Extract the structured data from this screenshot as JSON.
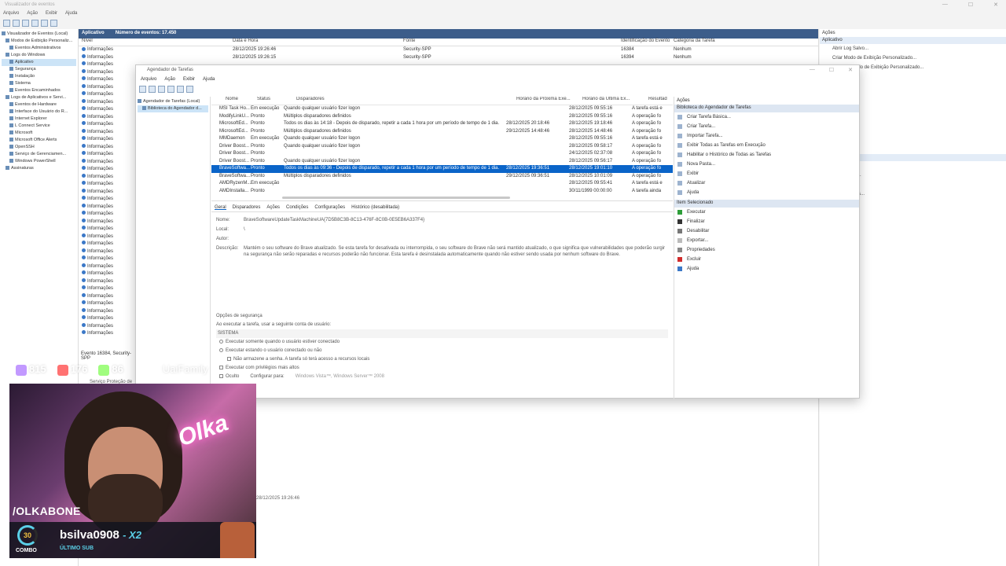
{
  "event_viewer": {
    "title": "Visualizador de eventos",
    "menu": [
      "Arquivo",
      "Ação",
      "Exibir",
      "Ajuda"
    ],
    "tree": [
      {
        "label": "Visualizador de Eventos (Local)",
        "indent": 0
      },
      {
        "label": "Modos de Exibição Personaliz...",
        "indent": 1
      },
      {
        "label": "Eventos Administrativos",
        "indent": 2
      },
      {
        "label": "Logs do Windows",
        "indent": 1
      },
      {
        "label": "Aplicativo",
        "indent": 2,
        "selected": true
      },
      {
        "label": "Segurança",
        "indent": 2
      },
      {
        "label": "Instalação",
        "indent": 2
      },
      {
        "label": "Sistema",
        "indent": 2
      },
      {
        "label": "Eventos Encaminhados",
        "indent": 2
      },
      {
        "label": "Logs de Aplicativos e Servi...",
        "indent": 1
      },
      {
        "label": "Eventos de Hardware",
        "indent": 2
      },
      {
        "label": "Interface do Usuário do R...",
        "indent": 2
      },
      {
        "label": "Internet Explorer",
        "indent": 2
      },
      {
        "label": "L Connect Service",
        "indent": 2
      },
      {
        "label": "Microsoft",
        "indent": 2
      },
      {
        "label": "Microsoft Office Alerts",
        "indent": 2
      },
      {
        "label": "OpenSSH",
        "indent": 2
      },
      {
        "label": "Serviço de Gerenciamen...",
        "indent": 2
      },
      {
        "label": "Windows PowerShell",
        "indent": 2
      },
      {
        "label": "Assinaturas",
        "indent": 1
      }
    ],
    "list_header": {
      "title": "Aplicativo",
      "count": "Número de eventos: 17.450"
    },
    "columns": [
      "Nível",
      "Data e Hora",
      "Fonte",
      "Identificação do Evento",
      "Categoria da Tarefa"
    ],
    "rows": [
      [
        "Informações",
        "28/12/2025 19:26:46",
        "Security-SPP",
        "16384",
        "Nenhum"
      ],
      [
        "Informações",
        "28/12/2025 19:26:15",
        "Security-SPP",
        "16394",
        "Nenhum"
      ]
    ],
    "info_label": "Informações",
    "bottom_event": "Evento 16384, Security-SPP",
    "bottom_tab": "Serviço Proteção de S...",
    "bottom_timestamp": "28/12/2025 19:26:46",
    "actions_title": "Ações",
    "actions_sub": "Aplicativo",
    "actions": [
      "Abrir Log Salvo...",
      "Criar Modo de Exibição Personalizado...",
      "Importar Modo de Exibição Personalizado...",
      "como...",
      "a este Log...",
      "-SPP",
      "r Evento",
      "este Evento...",
      "Selecionados..."
    ]
  },
  "task_scheduler": {
    "title": "Agendador de Tarefas",
    "menu": [
      "Arquivo",
      "Ação",
      "Exibir",
      "Ajuda"
    ],
    "tree": [
      "Agendador de Tarefas (Local)",
      "Biblioteca do Agendador d..."
    ],
    "columns": [
      "Nome",
      "Status",
      "Disparadores",
      "Horário da Próxima Exe...",
      "Horário da Última Ex...",
      "Resultad"
    ],
    "rows": [
      {
        "name": "MSI Task Ho...",
        "status": "Em execução",
        "trigger": "Quando qualquer usuário fizer logon",
        "next": "",
        "last": "28/12/2025 09:55:16",
        "result": "A tarefa está e"
      },
      {
        "name": "ModifyLinkU...",
        "status": "Pronto",
        "trigger": "Múltiplos disparadores definidos",
        "next": "",
        "last": "28/12/2025 09:55:16",
        "result": "A operação fo"
      },
      {
        "name": "MicrosoftEd...",
        "status": "Pronto",
        "trigger": "Todos os dias às 14:18 - Depois de disparado, repetir a cada 1 hora por um período de tempo de 1 dia.",
        "next": "28/12/2025 20:18:46",
        "last": "28/12/2025 19:18:46",
        "result": "A operação fo"
      },
      {
        "name": "MicrosoftEd...",
        "status": "Pronto",
        "trigger": "Múltiplos disparadores definidos",
        "next": "29/12/2025 14:48:46",
        "last": "28/12/2025 14:48:46",
        "result": "A operação fo"
      },
      {
        "name": "MMDaemon",
        "status": "Em execução",
        "trigger": "Quando qualquer usuário fizer logon",
        "next": "",
        "last": "28/12/2025 09:55:16",
        "result": "A tarefa está e"
      },
      {
        "name": "Driver Boost...",
        "status": "Pronto",
        "trigger": "Quando qualquer usuário fizer logon",
        "next": "",
        "last": "28/12/2025 09:58:17",
        "result": "A operação fo"
      },
      {
        "name": "Driver Boost...",
        "status": "Pronto",
        "trigger": "",
        "next": "",
        "last": "24/12/2025 02:37:08",
        "result": "A operação fo"
      },
      {
        "name": "Driver Boost...",
        "status": "Pronto",
        "trigger": "Quando qualquer usuário fizer logon",
        "next": "",
        "last": "28/12/2025 09:56:17",
        "result": "A operação fo"
      },
      {
        "name": "BraveSoftwa...",
        "status": "Pronto",
        "trigger": "Todos os dias às 09:36 - Depois de disparado, repetir a cada 1 hora por um período de tempo de 1 dia.",
        "next": "28/12/2025 19:36:51",
        "last": "28/12/2025 19:01:10",
        "result": "A operação fo",
        "selected": true
      },
      {
        "name": "BraveSoftwa...",
        "status": "Pronto",
        "trigger": "Múltiplos disparadores definidos",
        "next": "29/12/2025 09:36:51",
        "last": "28/12/2025 10:01:09",
        "result": "A operação fo"
      },
      {
        "name": "AMDRyzenM...",
        "status": "Em execução",
        "trigger": "",
        "next": "",
        "last": "28/12/2025 09:55:41",
        "result": "A tarefa está e"
      },
      {
        "name": "AMDInstalla...",
        "status": "Pronto",
        "trigger": "",
        "next": "",
        "last": "30/11/1999 00:00:00",
        "result": "A tarefa ainda"
      }
    ],
    "tabs": [
      "Geral",
      "Disparadores",
      "Ações",
      "Condições",
      "Configurações",
      "Histórico (desabilitada)"
    ],
    "detail": {
      "name_label": "Nome:",
      "name_value": "BraveSoftwareUpdateTaskMachineUA{7D5B8C3B-8C13-476F-8C0B-0E5EB6A337F4}",
      "local_label": "Local:",
      "local_value": "\\",
      "author_label": "Autor:",
      "author_value": "",
      "desc_label": "Descrição:",
      "desc_value": "Mantém o seu software do Brave atualizado. Se esta tarefa for desativada ou interrompida, o seu software do Brave não será mantido atualizado, o que significa que vulnerabilidades que poderão surgir na segurança não serão reparadas e recursos poderão não funcionar. Esta tarefa é desinstalada automaticamente quando não estiver sendo usada por nenhum software do Brave."
    },
    "security": {
      "header": "Opções de segurança",
      "account_prompt": "Ao executar a tarefa, usar a seguinte conta de usuário:",
      "account": "SISTEMA",
      "opt1": "Executar somente quando o usuário estiver conectado",
      "opt2": "Executar estando o usuário conectado ou não",
      "opt3": "Não armazene a senha. A tarefa só terá acesso a recursos locais",
      "opt4": "Executar com privilégios mais altos",
      "hidden": "Oculto",
      "config_label": "Configurar para:",
      "config_value": "Windows Vista™, Windows Server™ 2008"
    },
    "actions_title": "Ações",
    "lib_header": "Biblioteca do Agendador de Tarefas",
    "lib_actions": [
      "Criar Tarefa Básica...",
      "Criar Tarefa...",
      "Importar Tarefa...",
      "Exibir Todas as Tarefas em Execução",
      "Habilitar o Histórico de Todas as Tarefas",
      "Nova Pasta...",
      "Exibir",
      "Atualizar",
      "Ajuda"
    ],
    "item_header": "Item Selecionado",
    "item_actions": [
      "Executar",
      "Finalizar",
      "Desabilitar",
      "Exportar...",
      "Propriedades",
      "Excluir",
      "Ajuda"
    ]
  },
  "stream_overlay": {
    "twitch_count": "815",
    "youtube_count": "176",
    "kick_count": "86",
    "watermark": "UaiFamily",
    "handle": "/OLKABONE",
    "neon_sign": "Olka",
    "combo_value": "30",
    "combo_label": "COMBO",
    "sub_user": "bsilva0908",
    "sub_multiplier": "- X2",
    "sub_label": "ÚLTIMO SUB"
  },
  "colors": {
    "selection_blue": "#0a64c8",
    "header_blue": "#3c5d8a",
    "twitch": "#9146ff",
    "youtube": "#ff0000",
    "kick": "#53fc18",
    "accent_cyan": "#5ad0e8"
  }
}
